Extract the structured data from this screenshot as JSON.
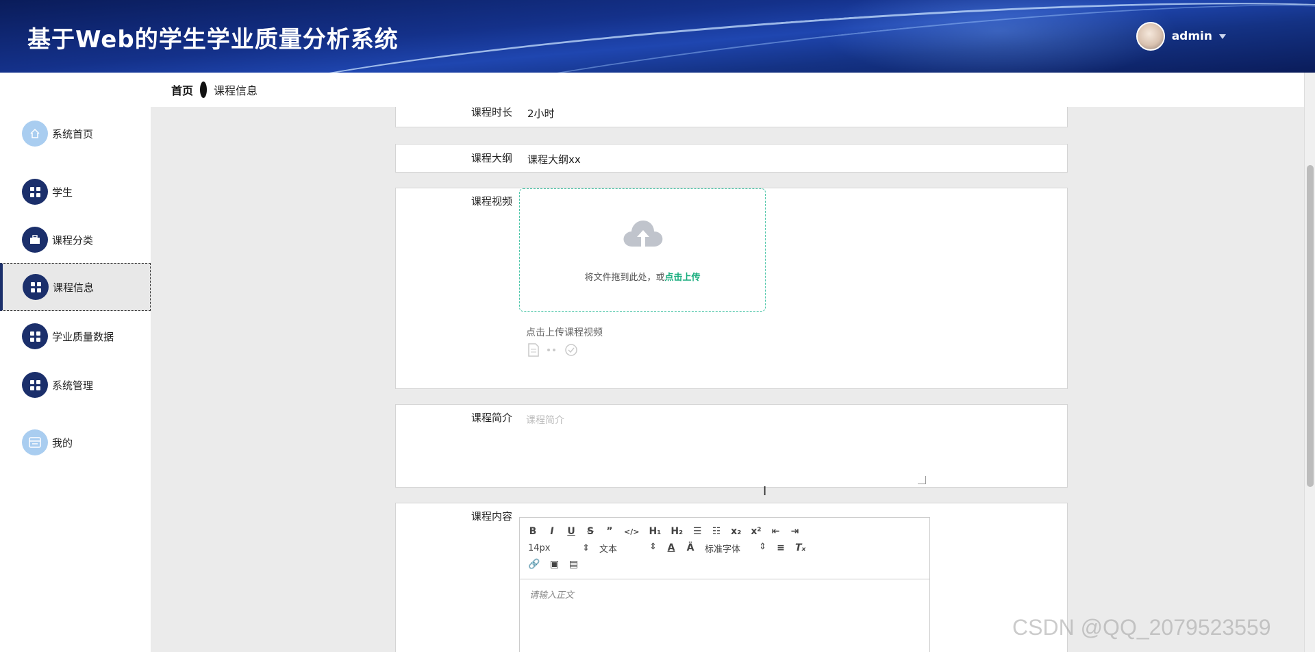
{
  "header": {
    "title": "基于Web的学生学业质量分析系统",
    "username": "admin"
  },
  "sidebar": {
    "items": [
      {
        "label": "系统首页",
        "icon": "home-icon"
      },
      {
        "label": "学生",
        "icon": "grid-icon"
      },
      {
        "label": "课程分类",
        "icon": "briefcase-icon"
      },
      {
        "label": "课程信息",
        "icon": "grid-icon",
        "active": true
      },
      {
        "label": "学业质量数据",
        "icon": "grid-icon"
      },
      {
        "label": "系统管理",
        "icon": "grid-icon"
      },
      {
        "label": "我的",
        "icon": "profile-card-icon"
      }
    ]
  },
  "breadcrumb": {
    "home": "首页",
    "current": "课程信息"
  },
  "form": {
    "duration": {
      "label": "课程时长",
      "value": "2小时"
    },
    "syllabus": {
      "label": "课程大纲",
      "value": "课程大纲xx"
    },
    "video": {
      "label": "课程视频",
      "upload_text": "将文件拖到此处，或",
      "upload_link": "点击上传",
      "hint": "点击上传课程视频"
    },
    "intro": {
      "label": "课程简介",
      "placeholder": "课程简介"
    },
    "content": {
      "label": "课程内容",
      "font_size": "14px",
      "text_type": "文本",
      "font_family": "标准字体",
      "placeholder": "请输入正文"
    }
  },
  "watermark": "CSDN @QQ_2079523559"
}
